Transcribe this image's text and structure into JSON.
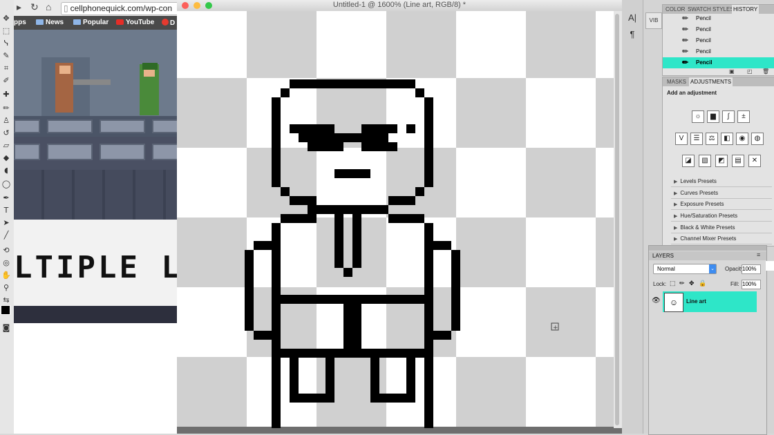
{
  "browser": {
    "url": "cellphonequick.com/wp-con",
    "bookmarks": [
      "pps",
      "News",
      "Popular",
      "YouTube",
      "D"
    ],
    "game_logo_text": "LTIPLE  L"
  },
  "document": {
    "title": "Untitled-1 @ 1600% (Line art, RGB/8) *"
  },
  "history": {
    "tabs": [
      "COLOR",
      "SWATCH",
      "STYLES",
      "HISTORY"
    ],
    "active_tab": "HISTORY",
    "items": [
      "Pencil",
      "Pencil",
      "Pencil",
      "Pencil",
      "Pencil"
    ],
    "selected_index": 4
  },
  "adjustments": {
    "tabs": [
      "MASKS",
      "ADJUSTMENTS"
    ],
    "active_tab": "ADJUSTMENTS",
    "header": "Add an adjustment",
    "presets": [
      "Levels Presets",
      "Curves Presets",
      "Exposure Presets",
      "Hue/Saturation Presets",
      "Black & White Presets",
      "Channel Mixer Presets"
    ]
  },
  "layers": {
    "title": "LAYERS",
    "blend_mode": "Normal",
    "opacity_label": "Opacity:",
    "opacity": "100%",
    "lock_label": "Lock:",
    "fill_label": "Fill:",
    "fill": "100%",
    "layer_name": "Line art"
  },
  "colors": {
    "selection_cyan": "#2ee6c8",
    "close_red": "#fc605b",
    "min_yellow": "#fdbc40",
    "max_green": "#34c84a"
  }
}
